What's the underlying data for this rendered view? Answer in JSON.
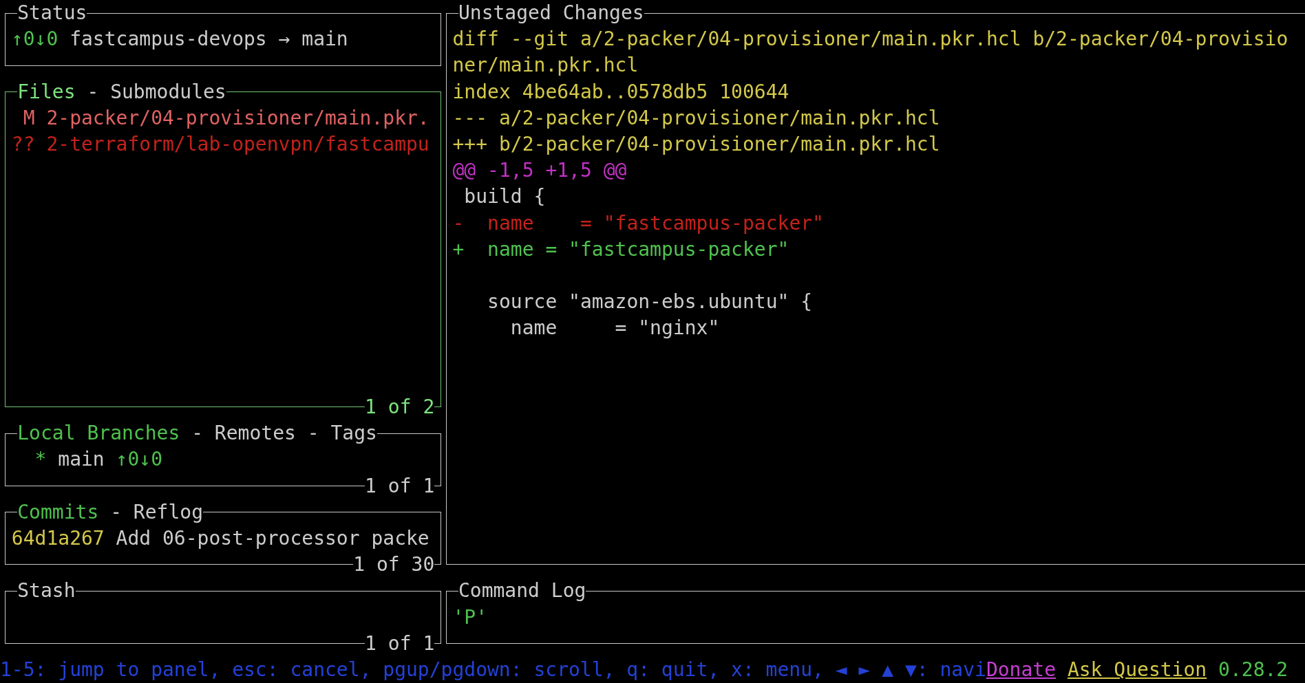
{
  "status": {
    "title": "Status",
    "focused": false,
    "tracking": "↑0↓0",
    "repo": "fastcampus-devops → main"
  },
  "files": {
    "focused": true,
    "separator": " - ",
    "tabs": [
      {
        "label": "Files",
        "selected": true
      },
      {
        "label": "Submodules",
        "selected": false
      }
    ],
    "items": [
      {
        "kind": "modified",
        "text": " M 2-packer/04-provisioner/main.pkr."
      },
      {
        "kind": "untracked",
        "text": "?? 2-terraform/lab-openvpn/fastcampu"
      }
    ],
    "counter": "1 of 2"
  },
  "branches": {
    "focused": false,
    "separator": " - ",
    "tabs": [
      {
        "label": "Local Branches",
        "selected": true
      },
      {
        "label": "Remotes",
        "selected": false
      },
      {
        "label": "Tags",
        "selected": false
      }
    ],
    "items": [
      {
        "marker": "*",
        "name": "main",
        "tracking": "↑0↓0"
      }
    ],
    "counter": "1 of 1"
  },
  "commits": {
    "focused": false,
    "separator": " - ",
    "tabs": [
      {
        "label": "Commits",
        "selected": true
      },
      {
        "label": "Reflog",
        "selected": false
      }
    ],
    "items": [
      {
        "hash": "64d1a267",
        "message": "Add 06-post-processor packe"
      }
    ],
    "counter": "1 of 30"
  },
  "stash": {
    "title": "Stash",
    "focused": false,
    "counter": "1 of 1"
  },
  "main": {
    "title": "Unstaged Changes",
    "focused": false,
    "lines": [
      {
        "kind": "header",
        "text": "diff --git a/2-packer/04-provisioner/main.pkr.hcl b/2-packer/04-provisio"
      },
      {
        "kind": "header",
        "text": "ner/main.pkr.hcl"
      },
      {
        "kind": "header",
        "text": "index 4be64ab..0578db5 100644"
      },
      {
        "kind": "header",
        "text": "--- a/2-packer/04-provisioner/main.pkr.hcl"
      },
      {
        "kind": "header",
        "text": "+++ b/2-packer/04-provisioner/main.pkr.hcl"
      },
      {
        "kind": "hunk",
        "text": "@@ -1,5 +1,5 @@"
      },
      {
        "kind": "context",
        "text": " build {"
      },
      {
        "kind": "removed",
        "text": "-  name    = \"fastcampus-packer\""
      },
      {
        "kind": "added",
        "text": "+  name = \"fastcampus-packer\""
      },
      {
        "kind": "blank"
      },
      {
        "kind": "context",
        "text": "   source \"amazon-ebs.ubuntu\" {"
      },
      {
        "kind": "context",
        "text": "     name     = \"nginx\""
      }
    ]
  },
  "command_log": {
    "title": "Command Log",
    "focused": false,
    "lines": [
      "'P'"
    ]
  },
  "status_bar": {
    "keybindings": "1-5: jump to panel, esc: cancel, pgup/pgdown: scroll, q: quit, x: menu, ◄ ► ▲ ▼: navi",
    "links": [
      {
        "kind": "donate",
        "text": "Donate"
      },
      {
        "kind": "ask",
        "text": "Ask Question"
      }
    ],
    "version": "0.28.2"
  }
}
